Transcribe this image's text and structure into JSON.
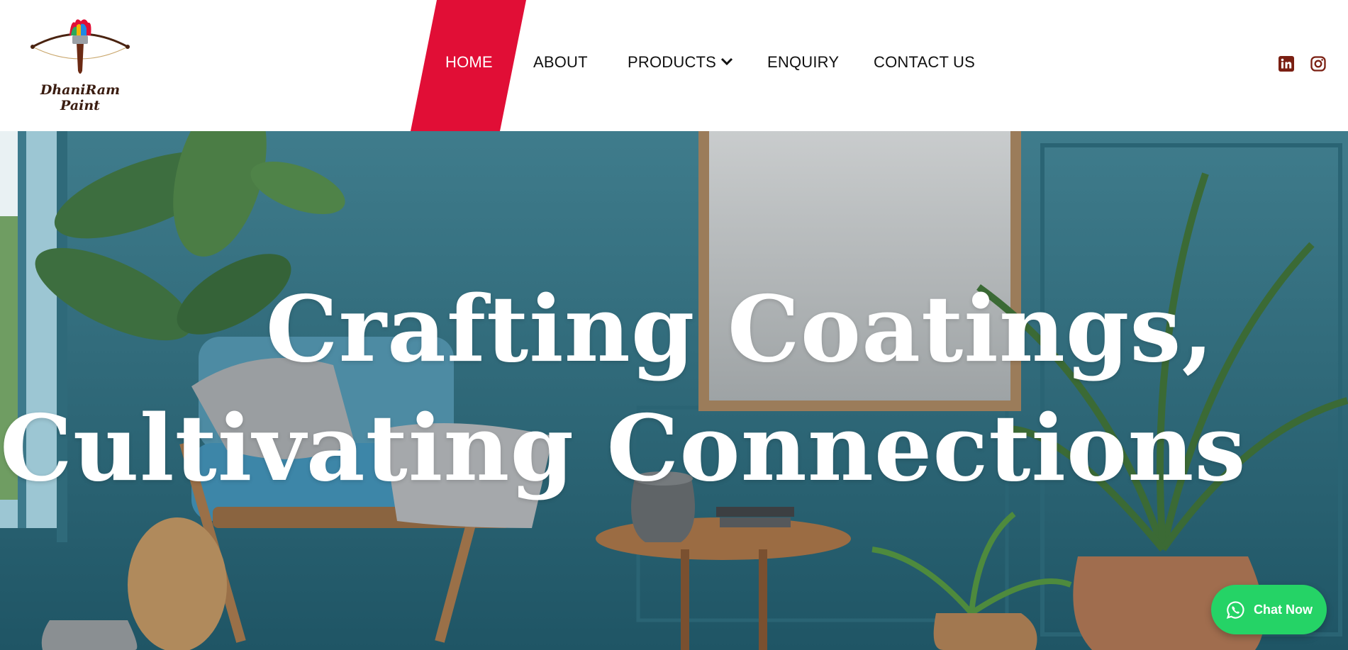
{
  "brand": {
    "name": "DhaniRam Paint",
    "accent_color": "#e10e36",
    "logo_icon": "paintbrush-bow-icon"
  },
  "nav": {
    "items": [
      {
        "label": "HOME",
        "active": true
      },
      {
        "label": "ABOUT",
        "active": false
      },
      {
        "label": "PRODUCTS",
        "active": false,
        "icon": "chevron-down-icon"
      },
      {
        "label": "ENQUIRY",
        "active": false
      },
      {
        "label": "CONTACT US",
        "active": false
      }
    ]
  },
  "social": {
    "linkedin_icon": "linkedin-icon",
    "instagram_icon": "instagram-icon",
    "icon_color": "#7a1f12"
  },
  "hero": {
    "headline_line1": "Crafting Coatings,",
    "headline_line2": "Cultivating Connections",
    "background": "living-room-interior-image"
  },
  "chat": {
    "label": "Chat Now",
    "icon": "whatsapp-icon",
    "color": "#25d366"
  }
}
